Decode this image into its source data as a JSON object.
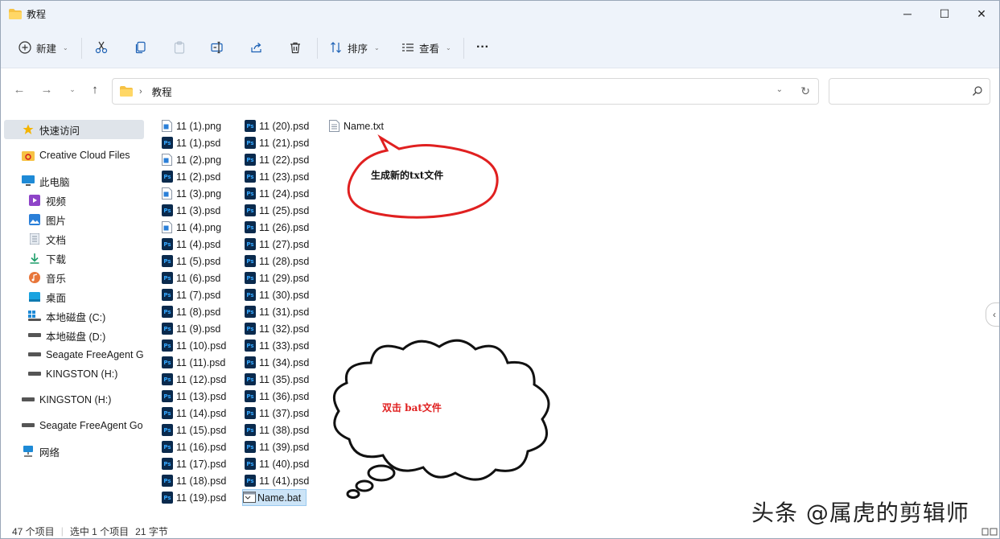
{
  "window": {
    "title": "教程",
    "minimize": "─",
    "maximize": "☐",
    "close": "✕"
  },
  "toolbar": {
    "new_label": "新建",
    "sort_label": "排序",
    "view_label": "查看",
    "more_label": "···"
  },
  "address": {
    "crumb": "教程",
    "search_placeholder": ""
  },
  "nav": {
    "quick_access": "快速访问",
    "creative_cloud": "Creative Cloud Files",
    "this_pc": "此电脑",
    "videos": "视频",
    "pictures": "图片",
    "documents": "文档",
    "downloads": "下载",
    "music": "音乐",
    "desktop": "桌面",
    "disk_c": "本地磁盘 (C:)",
    "disk_d": "本地磁盘 (D:)",
    "seagate_sub": "Seagate FreeAgent G",
    "kingston_sub": "KINGSTON (H:)",
    "kingston": "KINGSTON (H:)",
    "seagate": "Seagate FreeAgent Go",
    "network": "网络"
  },
  "files": {
    "col1": [
      {
        "name": "11 (1).png",
        "type": "png"
      },
      {
        "name": "11 (1).psd",
        "type": "psd"
      },
      {
        "name": "11 (2).png",
        "type": "png"
      },
      {
        "name": "11 (2).psd",
        "type": "psd"
      },
      {
        "name": "11 (3).png",
        "type": "png"
      },
      {
        "name": "11 (3).psd",
        "type": "psd"
      },
      {
        "name": "11 (4).png",
        "type": "png"
      },
      {
        "name": "11 (4).psd",
        "type": "psd"
      },
      {
        "name": "11 (5).psd",
        "type": "psd"
      },
      {
        "name": "11 (6).psd",
        "type": "psd"
      },
      {
        "name": "11 (7).psd",
        "type": "psd"
      },
      {
        "name": "11 (8).psd",
        "type": "psd"
      },
      {
        "name": "11 (9).psd",
        "type": "psd"
      },
      {
        "name": "11 (10).psd",
        "type": "psd"
      },
      {
        "name": "11 (11).psd",
        "type": "psd"
      },
      {
        "name": "11 (12).psd",
        "type": "psd"
      },
      {
        "name": "11 (13).psd",
        "type": "psd"
      },
      {
        "name": "11 (14).psd",
        "type": "psd"
      },
      {
        "name": "11 (15).psd",
        "type": "psd"
      },
      {
        "name": "11 (16).psd",
        "type": "psd"
      },
      {
        "name": "11 (17).psd",
        "type": "psd"
      },
      {
        "name": "11 (18).psd",
        "type": "psd"
      },
      {
        "name": "11 (19).psd",
        "type": "psd"
      }
    ],
    "col2": [
      {
        "name": "11 (20).psd",
        "type": "psd"
      },
      {
        "name": "11 (21).psd",
        "type": "psd"
      },
      {
        "name": "11 (22).psd",
        "type": "psd"
      },
      {
        "name": "11 (23).psd",
        "type": "psd"
      },
      {
        "name": "11 (24).psd",
        "type": "psd"
      },
      {
        "name": "11 (25).psd",
        "type": "psd"
      },
      {
        "name": "11 (26).psd",
        "type": "psd"
      },
      {
        "name": "11 (27).psd",
        "type": "psd"
      },
      {
        "name": "11 (28).psd",
        "type": "psd"
      },
      {
        "name": "11 (29).psd",
        "type": "psd"
      },
      {
        "name": "11 (30).psd",
        "type": "psd"
      },
      {
        "name": "11 (31).psd",
        "type": "psd"
      },
      {
        "name": "11 (32).psd",
        "type": "psd"
      },
      {
        "name": "11 (33).psd",
        "type": "psd"
      },
      {
        "name": "11 (34).psd",
        "type": "psd"
      },
      {
        "name": "11 (35).psd",
        "type": "psd"
      },
      {
        "name": "11 (36).psd",
        "type": "psd"
      },
      {
        "name": "11 (37).psd",
        "type": "psd"
      },
      {
        "name": "11 (38).psd",
        "type": "psd"
      },
      {
        "name": "11 (39).psd",
        "type": "psd"
      },
      {
        "name": "11 (40).psd",
        "type": "psd"
      },
      {
        "name": "11 (41).psd",
        "type": "psd"
      },
      {
        "name": "Name.bat",
        "type": "bat",
        "selected": true
      }
    ],
    "col3": [
      {
        "name": "Name.txt",
        "type": "txt"
      }
    ]
  },
  "annotations": {
    "ellipse_text": "生成新的txt文件",
    "cloud_text": "双击 bat文件",
    "ellipse_color": "#e02020",
    "cloud_text_color": "#e02020"
  },
  "status": {
    "item_count": "47 个项目",
    "selected": "选中 1 个项目",
    "size": "21 字节"
  },
  "watermark": "头条 @属虎的剪辑师",
  "colors": {
    "accent": "#0067c0",
    "selection_bg": "#cce4f7",
    "folder": "#f6c244",
    "ps_blue": "#0a2a4d"
  }
}
